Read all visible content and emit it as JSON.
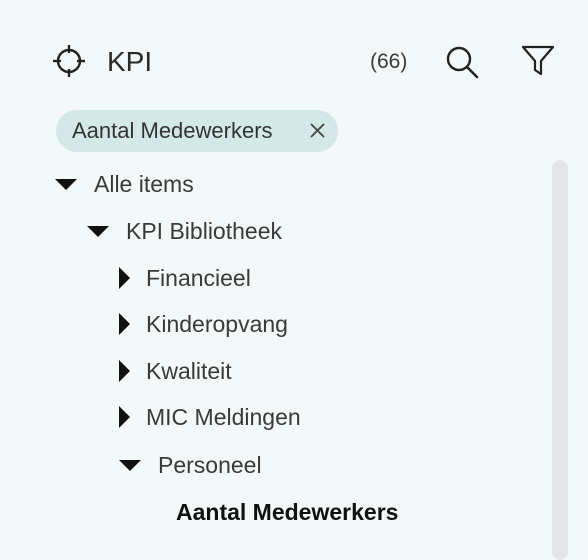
{
  "header": {
    "title": "KPI",
    "count": "(66)",
    "kpi_icon": "crosshair-icon",
    "search_icon": "search-icon",
    "filter_icon": "filter-icon"
  },
  "active_filter": {
    "label": "Aantal Medewerkers",
    "close_icon": "close-icon"
  },
  "tree": {
    "root": {
      "label": "Alle items",
      "state": "expanded"
    },
    "library": {
      "label": "KPI Bibliotheek",
      "state": "expanded"
    },
    "items": [
      {
        "label": "Financieel",
        "state": "collapsed"
      },
      {
        "label": "Kinderopvang",
        "state": "collapsed"
      },
      {
        "label": "Kwaliteit",
        "state": "collapsed"
      },
      {
        "label": "MIC Meldingen",
        "state": "collapsed"
      },
      {
        "label": "Personeel",
        "state": "expanded"
      }
    ],
    "selected_leaf": {
      "label": "Aantal Medewerkers"
    }
  },
  "colors": {
    "background": "#f3f8f8",
    "chip": "#d3e8e7",
    "scrollbar": "#e3e6e6"
  }
}
